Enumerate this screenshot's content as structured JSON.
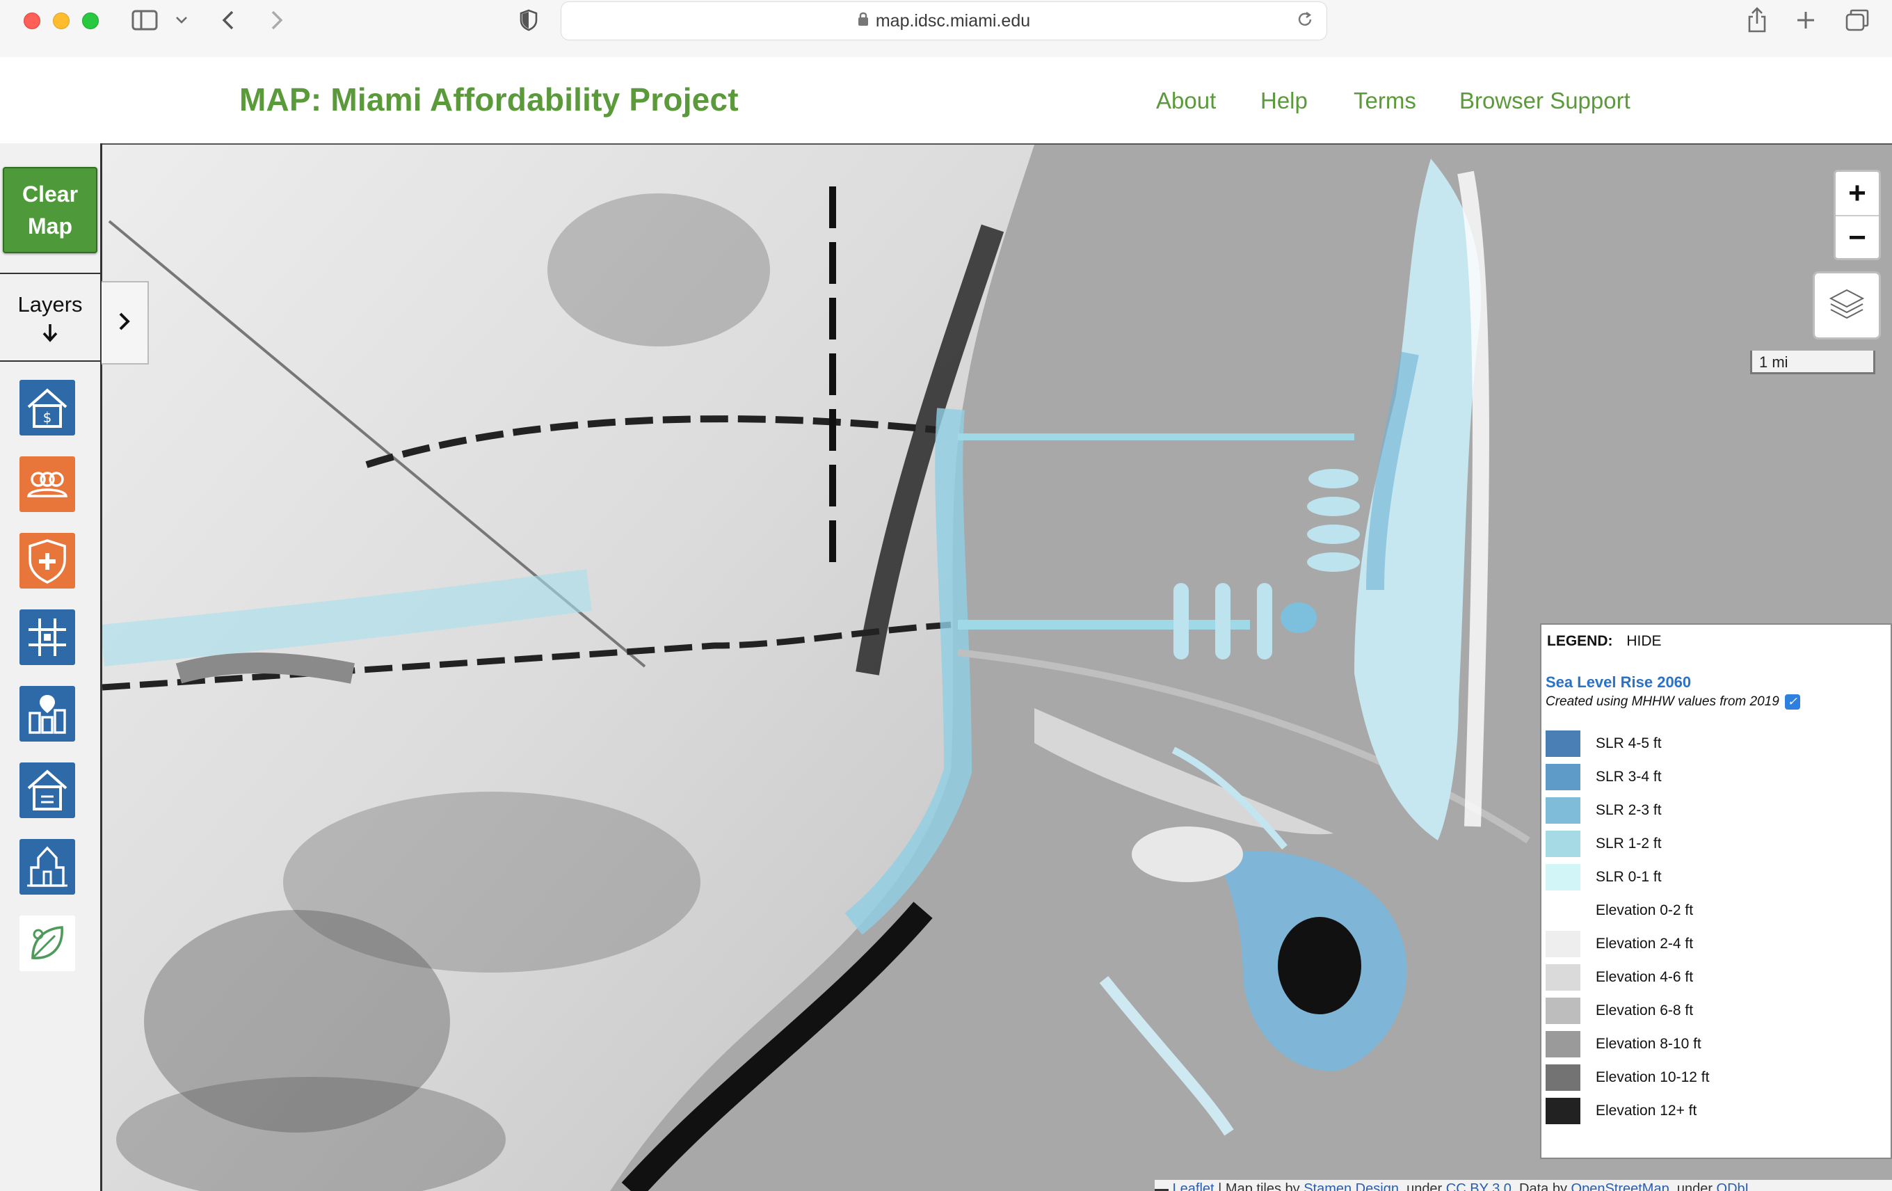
{
  "browser": {
    "url": "map.idsc.miami.edu"
  },
  "header": {
    "title": "MAP: Miami Affordability Project",
    "nav": [
      "About",
      "Help",
      "Terms",
      "Browser Support"
    ]
  },
  "sidebar": {
    "clear_map": [
      "Clear",
      "Map"
    ],
    "layers_label": "Layers",
    "tools": [
      "housing-cost-icon",
      "people-icon",
      "health-shield-icon",
      "grid-icon",
      "city-location-icon",
      "home-icon",
      "building-icon",
      "map-leaf-icon"
    ]
  },
  "map": {
    "scale_label": "1 mi",
    "zoom_in": "+",
    "zoom_out": "−",
    "attribution": {
      "leaflet": "Leaflet",
      "text1": " | Map tiles by ",
      "stamen": "Stamen Design",
      "text2": ", under ",
      "ccby": "CC BY 3.0",
      "text3": ". Data by ",
      "osm": "OpenStreetMap",
      "text4": ", under ",
      "odbl": "ODbL"
    }
  },
  "legend": {
    "label": "LEGEND:",
    "hide": "HIDE",
    "title": "Sea Level Rise 2060",
    "subtitle": "Created using MHHW values from 2019",
    "items": [
      {
        "label": "SLR 4-5 ft",
        "color": "#4a7fb6"
      },
      {
        "label": "SLR 3-4 ft",
        "color": "#5f9bc8"
      },
      {
        "label": "SLR 2-3 ft",
        "color": "#7fbcd9"
      },
      {
        "label": "SLR 1-2 ft",
        "color": "#a6dbe5"
      },
      {
        "label": "SLR 0-1 ft",
        "color": "#d2f5f8"
      },
      {
        "label": "Elevation 0-2 ft",
        "color": "#ffffff"
      },
      {
        "label": "Elevation 2-4 ft",
        "color": "#eeeeee"
      },
      {
        "label": "Elevation 4-6 ft",
        "color": "#dadada"
      },
      {
        "label": "Elevation 6-8 ft",
        "color": "#bdbdbd"
      },
      {
        "label": "Elevation 8-10 ft",
        "color": "#9a9a9a"
      },
      {
        "label": "Elevation 10-12 ft",
        "color": "#737373"
      },
      {
        "label": "Elevation 12+ ft",
        "color": "#222222"
      }
    ]
  }
}
